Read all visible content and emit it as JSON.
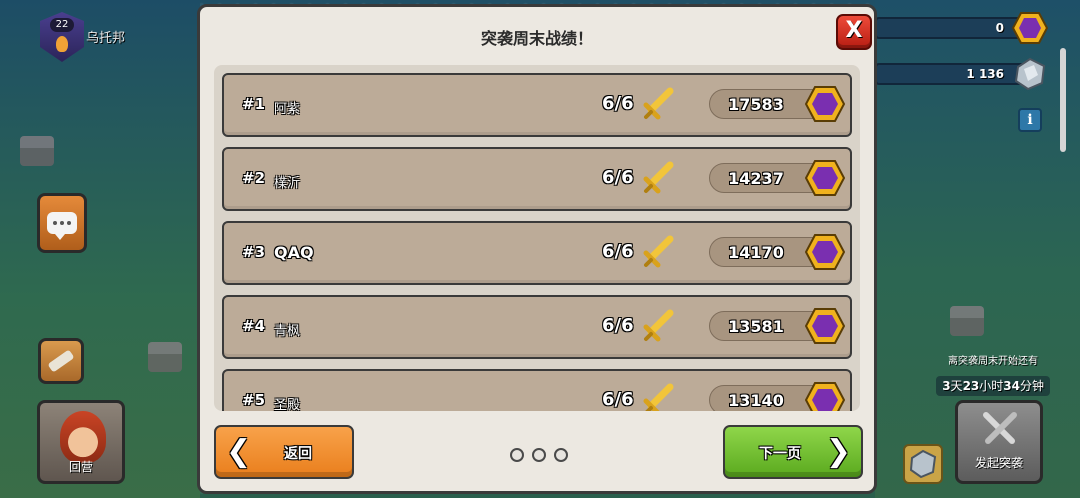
{
  "hud": {
    "league_level": "22",
    "clan_name": "乌托邦",
    "resources": [
      {
        "name": "raid-medal",
        "value": "0"
      },
      {
        "name": "capital-gold",
        "value": "1 136"
      }
    ],
    "camp_label": "回营",
    "raid_note": "离突袭周末开始还有",
    "raid_timer": {
      "days": "3",
      "days_unit": "天",
      "hours": "23",
      "hours_unit": "小时",
      "minutes": "34",
      "minutes_unit": "分钟"
    },
    "start_raid_label": "发起突袭",
    "info_label": "i"
  },
  "modal": {
    "title": "突袭周末战绩！",
    "close_label": "X",
    "rows": [
      {
        "rank": "#1",
        "player": "阿紫",
        "attacks": "6/6",
        "score": "17583"
      },
      {
        "rank": "#2",
        "player": "檏沂",
        "attacks": "6/6",
        "score": "14237"
      },
      {
        "rank": "#3",
        "player": "QAQ",
        "attacks": "6/6",
        "score": "14170"
      },
      {
        "rank": "#4",
        "player": "青枫",
        "attacks": "6/6",
        "score": "13581"
      },
      {
        "rank": "#5",
        "player": "圣殿",
        "attacks": "6/6",
        "score": "13140"
      }
    ],
    "back_label": "返回",
    "next_label": "下一页",
    "back_chevron": "❮",
    "next_chevron": "❯",
    "page_count": 3
  },
  "colors": {
    "medal_purple": "#7a2fb0",
    "medal_gold_frame": "#f0b21e",
    "sword_gold": "#f2c53a",
    "back_orange": "#f39434",
    "next_green": "#78c43a",
    "close_red": "#d8352a"
  },
  "icons": [
    "shield-league-icon",
    "chat-icon",
    "hammer-icon",
    "raid-medal-icon",
    "capital-gold-icon",
    "info-icon",
    "crossed-swords-icon",
    "golden-sword-icon",
    "close-icon",
    "chevron-left-icon",
    "chevron-right-icon"
  ]
}
